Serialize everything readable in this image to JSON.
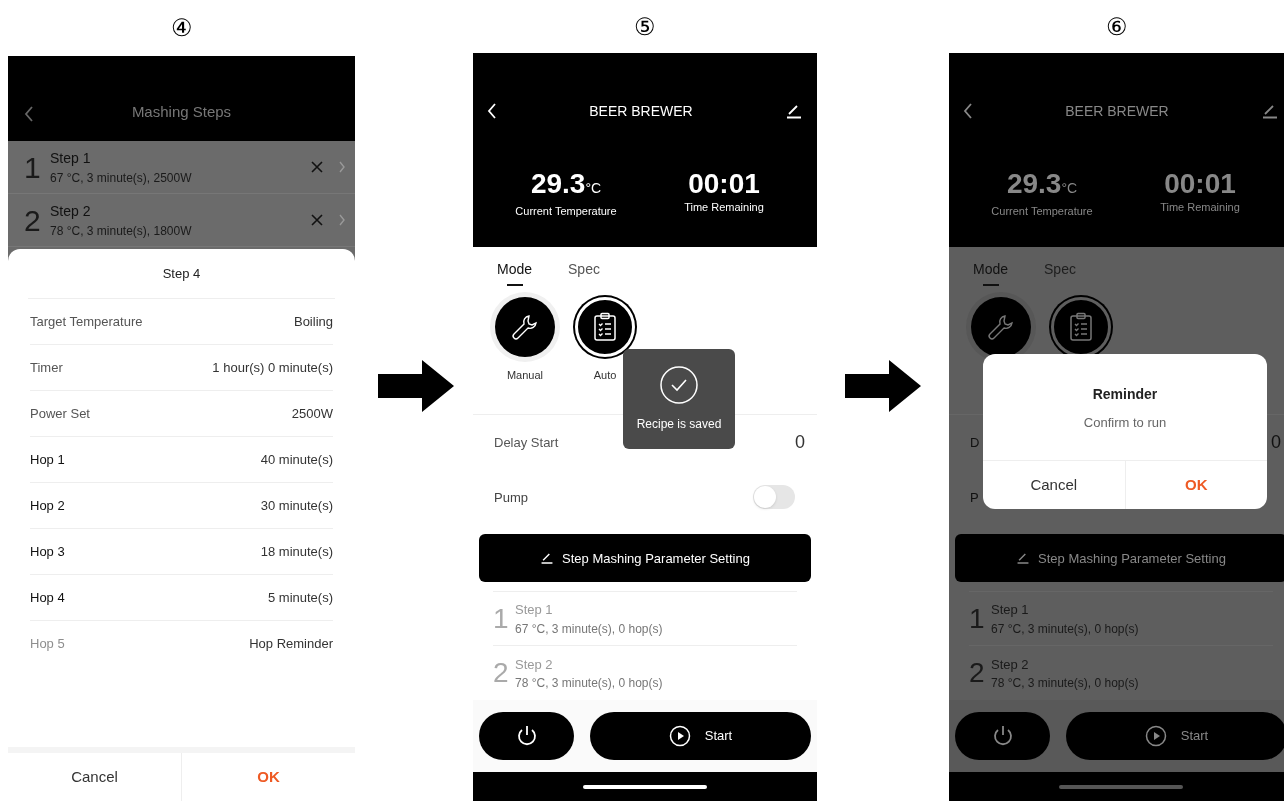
{
  "step_labels": [
    "④",
    "⑤",
    "⑥"
  ],
  "screen_4": {
    "title": "Mashing Steps",
    "steps": [
      {
        "number": "1",
        "name": "Step 1",
        "detail": "67 °C, 3 minute(s), 2500W"
      },
      {
        "number": "2",
        "name": "Step 2",
        "detail": "78 °C, 3 minute(s), 1800W"
      }
    ],
    "sheet": {
      "title": "Step 4",
      "rows": [
        {
          "kind": "setting",
          "label": "Target Temperature",
          "value": "Boiling",
          "disabled": false
        },
        {
          "kind": "setting",
          "label": "Timer",
          "value": "1 hour(s) 0 minute(s)",
          "disabled": false
        },
        {
          "kind": "setting",
          "label": "Power Set",
          "value": "2500W",
          "disabled": false
        },
        {
          "kind": "hop",
          "label": "Hop 1",
          "value": "40 minute(s)",
          "disabled": false
        },
        {
          "kind": "hop",
          "label": "Hop 2",
          "value": "30 minute(s)",
          "disabled": false
        },
        {
          "kind": "hop",
          "label": "Hop 3",
          "value": "18 minute(s)",
          "disabled": false
        },
        {
          "kind": "hop",
          "label": "Hop 4",
          "value": "5 minute(s)",
          "disabled": false
        },
        {
          "kind": "hop",
          "label": "Hop 5",
          "value": "Hop Reminder",
          "disabled": true
        }
      ],
      "buttons": [
        {
          "kind": "cancel",
          "label": "Cancel"
        },
        {
          "kind": "confirm",
          "label": "OK"
        }
      ]
    }
  },
  "screen_5": {
    "title": "BEER BREWER",
    "temperature": "29.3",
    "temperature_unit": "°C",
    "temperature_label": "Current Temperature",
    "time": "00:01",
    "time_label": "Time Remaining",
    "tabs": [
      {
        "label": "Mode",
        "selected": true
      },
      {
        "label": "Spec",
        "selected": false
      }
    ],
    "modes": [
      {
        "kind": "manual",
        "label": "Manual",
        "selected": false
      },
      {
        "kind": "auto",
        "label": "Auto",
        "selected": true
      }
    ],
    "toast": {
      "message": "Recipe is saved"
    },
    "delay_start": {
      "label": "Delay Start",
      "value": "0"
    },
    "pump": {
      "label": "Pump",
      "on": false
    },
    "setting_button": "Step Mashing Parameter Setting",
    "steps": [
      {
        "number": "1",
        "name": "Step 1",
        "detail": "67 °C, 3 minute(s), 0 hop(s)"
      },
      {
        "number": "2",
        "name": "Step 2",
        "detail": "78 °C, 3 minute(s), 0 hop(s)"
      }
    ],
    "start_button": "Start"
  },
  "screen_6": {
    "title": "BEER BREWER",
    "temperature": "29.3",
    "temperature_unit": "°C",
    "temperature_label": "Current Temperature",
    "time": "00:01",
    "time_label": "Time Remaining",
    "tabs": [
      {
        "label": "Mode",
        "selected": true
      },
      {
        "label": "Spec",
        "selected": false
      }
    ],
    "modes": [
      {
        "kind": "manual",
        "selected": false
      },
      {
        "kind": "auto",
        "selected": true
      }
    ],
    "delay_start": {
      "label": "D",
      "value": "0"
    },
    "pump": {
      "label": "P"
    },
    "setting_button": "Step Mashing Parameter Setting",
    "steps": [
      {
        "number": "1",
        "name": "Step 1",
        "detail": "67 °C, 3 minute(s), 0 hop(s)"
      },
      {
        "number": "2",
        "name": "Step 2",
        "detail": "78 °C, 3 minute(s), 0 hop(s)"
      }
    ],
    "start_button": "Start",
    "dialog": {
      "title": "Reminder",
      "message": "Confirm to run",
      "buttons": [
        {
          "kind": "cancel",
          "label": "Cancel"
        },
        {
          "kind": "confirm",
          "label": "OK"
        }
      ]
    }
  }
}
